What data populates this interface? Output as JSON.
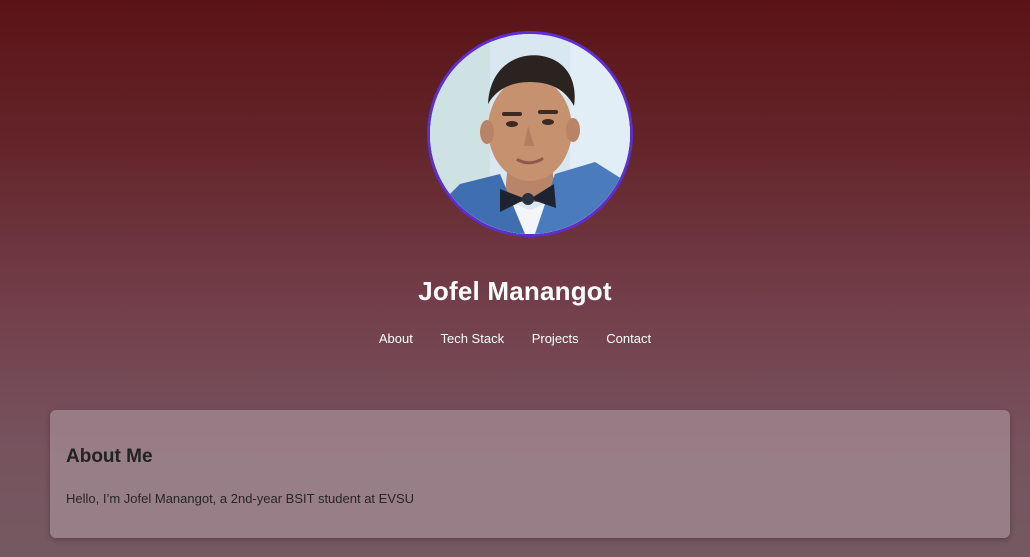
{
  "header": {
    "name": "Jofel Manangot",
    "avatar_icon": "profile-photo"
  },
  "nav": {
    "items": [
      {
        "label": "About"
      },
      {
        "label": "Tech Stack"
      },
      {
        "label": "Projects"
      },
      {
        "label": "Contact"
      }
    ]
  },
  "about": {
    "heading": "About Me",
    "text": "Hello, I’m Jofel Manangot, a 2nd-year BSIT student at EVSU"
  },
  "colors": {
    "background_top": "#5b1317",
    "background_bottom": "#755961",
    "avatar_border": "#5d2ed0",
    "text_light": "#ffffff",
    "text_dark": "#222222"
  }
}
